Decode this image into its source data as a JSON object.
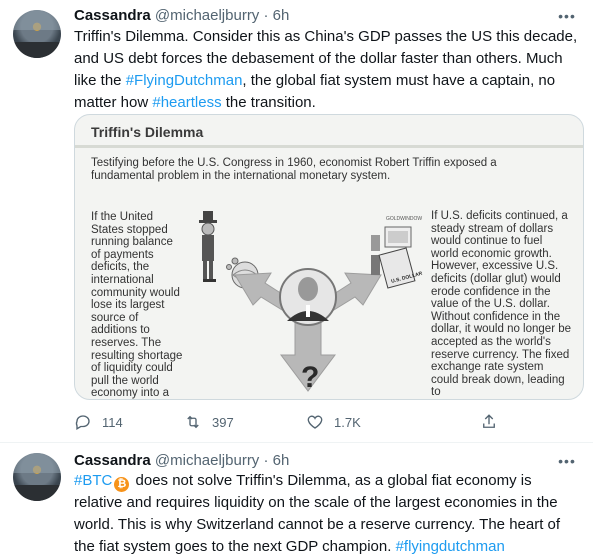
{
  "tweets": [
    {
      "author_name": "Cassandra",
      "handle": "@michaeljburry",
      "separator": "·",
      "time": "6h",
      "text_parts": [
        "Triffin's Dilemma. Consider this as China's GDP passes the US this decade, and US debt forces the debasement of the dollar faster than others. Much like the ",
        "#FlyingDutchman",
        ", the global fiat system must have a captain, no matter how ",
        "#heartless",
        " the transition."
      ],
      "image": {
        "title": "Triffin's Dilemma",
        "intro": "Testifying before the U.S. Congress in 1960, economist Robert Triffin exposed a fundamental problem in the international monetary system.",
        "left_text": "If the United States stopped running balance of payments deficits, the international community would lose its largest source of additions to reserves. The resulting shortage of liquidity could pull the world economy into a contractionary",
        "right_text": "If U.S. deficits continued, a steady stream of dollars would continue to fuel world economic growth. However, excessive U.S. deficits (dollar glut) would erode confidence in the value of the U.S. dollar. Without confidence in the dollar, it would no longer be accepted as the world's reserve currency. The fixed exchange rate system could break down, leading to",
        "small_label": "GOLDWINDOW",
        "dollar_label": "U.S. DOLLAR",
        "question_mark": "?"
      },
      "actions": {
        "replies": "114",
        "retweets": "397",
        "likes": "1.7K"
      }
    },
    {
      "author_name": "Cassandra",
      "handle": "@michaeljburry",
      "separator": "·",
      "time": "6h",
      "text_parts": [
        "#BTC",
        " does not solve Triffin's Dilemma, as a global fiat economy is relative and requires liquidity on the scale of the largest economies in the world. This is why Switzerland cannot be a reserve currency. The heart of the fiat system goes to the next GDP champion. ",
        "#flyingdutchman"
      ],
      "btc_symbol": "₿"
    }
  ],
  "colors": {
    "link": "#1d9bf0",
    "muted": "#536471",
    "text": "#0f1419",
    "btc": "#f7931a"
  },
  "icons": [
    "more-icon",
    "reply-icon",
    "retweet-icon",
    "like-icon",
    "share-icon",
    "bitcoin-icon"
  ]
}
